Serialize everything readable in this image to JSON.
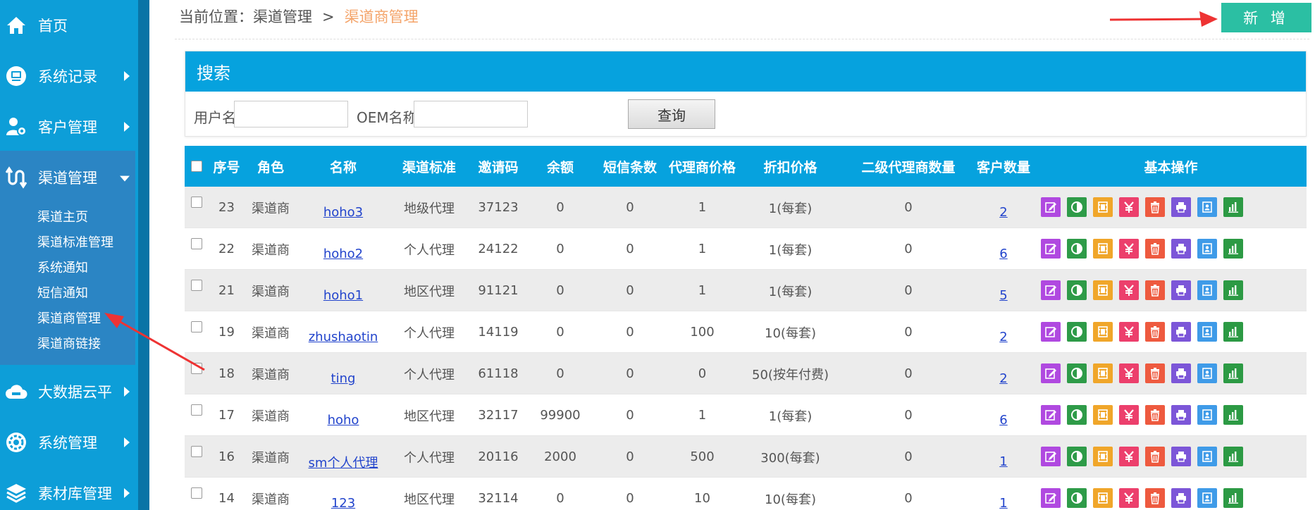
{
  "sidebar": {
    "items": [
      {
        "name": "nav-home",
        "icon": "home-icon",
        "label": "首页",
        "caret": "none"
      },
      {
        "name": "nav-system-log",
        "icon": "monitor-icon",
        "label": "系统记录",
        "caret": "right"
      },
      {
        "name": "nav-customer",
        "icon": "user-gear-icon",
        "label": "客户管理",
        "caret": "right"
      },
      {
        "name": "nav-channel",
        "icon": "channel-icon",
        "label": "渠道管理",
        "caret": "down"
      },
      {
        "name": "nav-bigdata",
        "icon": "cloud-icon",
        "label": "大数据云平",
        "caret": "right"
      },
      {
        "name": "nav-system-mgmt",
        "icon": "gear-icon",
        "label": "系统管理",
        "caret": "right"
      },
      {
        "name": "nav-material",
        "icon": "stack-icon",
        "label": "素材库管理",
        "caret": "right"
      }
    ],
    "channel_sub_items": [
      "渠道主页",
      "渠道标准管理",
      "系统通知",
      "短信通知",
      "渠道商管理",
      "渠道商链接"
    ]
  },
  "breadcrumb": {
    "prefix": "当前位置：渠道管理",
    "separator": ">",
    "current": "渠道商管理"
  },
  "toolbar": {
    "add_label": "新 增"
  },
  "search": {
    "title": "搜索",
    "username_label": "用户名",
    "username_value": "",
    "oem_label": "OEM名称",
    "oem_value": "",
    "query_label": "查询"
  },
  "table": {
    "headers": [
      "序号",
      "角色",
      "名称",
      "渠道标准",
      "邀请码",
      "余额",
      "短信条数",
      "代理商价格",
      "折扣价格",
      "二级代理商数量",
      "客户数量",
      "基本操作"
    ],
    "rows": [
      {
        "id": "23",
        "role": "渠道商",
        "name": "hoho3",
        "standard": "地级代理",
        "invite": "37123",
        "balance": "0",
        "sms": "0",
        "agent_price": "1",
        "discount": "1(每套)",
        "sub_agents": "0",
        "customers": "2"
      },
      {
        "id": "22",
        "role": "渠道商",
        "name": "hoho2",
        "standard": "个人代理",
        "invite": "24122",
        "balance": "0",
        "sms": "0",
        "agent_price": "1",
        "discount": "1(每套)",
        "sub_agents": "0",
        "customers": "6"
      },
      {
        "id": "21",
        "role": "渠道商",
        "name": "hoho1",
        "standard": "地区代理",
        "invite": "91121",
        "balance": "0",
        "sms": "0",
        "agent_price": "1",
        "discount": "1(每套)",
        "sub_agents": "0",
        "customers": "5"
      },
      {
        "id": "19",
        "role": "渠道商",
        "name": "zhushaotin",
        "standard": "个人代理",
        "invite": "14119",
        "balance": "0",
        "sms": "0",
        "agent_price": "100",
        "discount": "10(每套)",
        "sub_agents": "0",
        "customers": "2"
      },
      {
        "id": "18",
        "role": "渠道商",
        "name": "ting",
        "standard": "个人代理",
        "invite": "61118",
        "balance": "0",
        "sms": "0",
        "agent_price": "0",
        "discount": "50(按年付费)",
        "sub_agents": "0",
        "customers": "2"
      },
      {
        "id": "17",
        "role": "渠道商",
        "name": "hoho",
        "standard": "地区代理",
        "invite": "32117",
        "balance": "99900",
        "sms": "0",
        "agent_price": "1",
        "discount": "1(每套)",
        "sub_agents": "0",
        "customers": "6"
      },
      {
        "id": "16",
        "role": "渠道商",
        "name": "sm个人代理",
        "standard": "个人代理",
        "invite": "20116",
        "balance": "2000",
        "sms": "0",
        "agent_price": "500",
        "discount": "300(每套)",
        "sub_agents": "0",
        "customers": "1"
      },
      {
        "id": "14",
        "role": "渠道商",
        "name": "123",
        "standard": "地区代理",
        "invite": "32114",
        "balance": "0",
        "sms": "0",
        "agent_price": "10",
        "discount": "10(每套)",
        "sub_agents": "0",
        "customers": "1"
      }
    ],
    "operations": [
      {
        "name": "edit-icon",
        "color": "#b049e0"
      },
      {
        "name": "contrast-icon",
        "color": "#2e9b48"
      },
      {
        "name": "film-icon",
        "color": "#f0a62a"
      },
      {
        "name": "yen-icon",
        "color": "#ec3f6c"
      },
      {
        "name": "trash-icon",
        "color": "#ee5a3f"
      },
      {
        "name": "printer-icon",
        "color": "#7c56d8"
      },
      {
        "name": "contact-icon",
        "color": "#3f9be8"
      },
      {
        "name": "bar-chart-icon",
        "color": "#2c9a44"
      }
    ]
  },
  "colors": {
    "sidebar": "#0d9ed8",
    "header": "#06a2de",
    "accent": "#2bbfa3",
    "annotation": "#ee3333"
  }
}
